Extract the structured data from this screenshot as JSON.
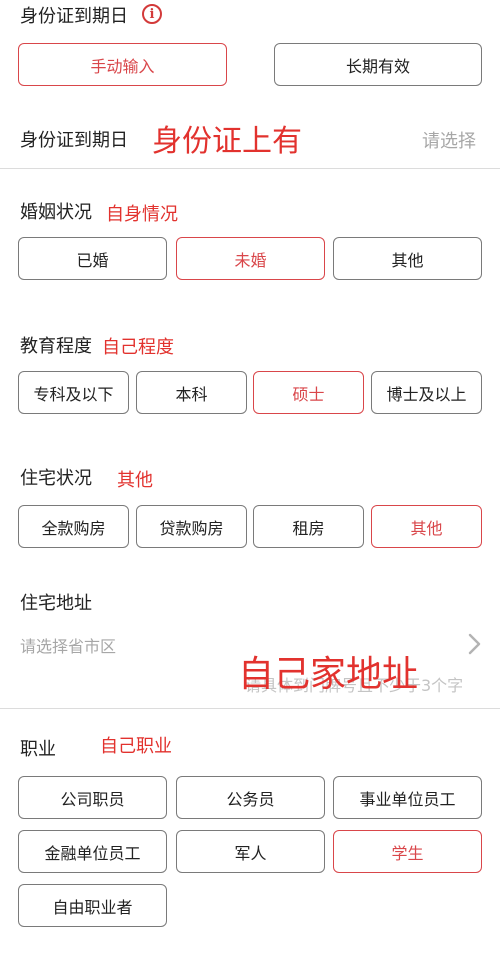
{
  "id_expiry_top": {
    "label": "身份证到期日",
    "info_icon": "i",
    "options": [
      "手动输入",
      "长期有效"
    ],
    "selected": "手动输入"
  },
  "id_expiry_row": {
    "label": "身份证到期日",
    "annotation": "身份证上有",
    "placeholder": "请选择"
  },
  "marital": {
    "label": "婚姻状况",
    "annotation": "自身情况",
    "options": [
      "已婚",
      "未婚",
      "其他"
    ],
    "selected": "未婚"
  },
  "education": {
    "label": "教育程度",
    "annotation": "自己程度",
    "options": [
      "专科及以下",
      "本科",
      "硕士",
      "博士及以上"
    ],
    "selected": "硕士"
  },
  "housing": {
    "label": "住宅状况",
    "annotation": "其他",
    "options": [
      "全款购房",
      "贷款购房",
      "租房",
      "其他"
    ],
    "selected": "其他"
  },
  "address": {
    "label": "住宅地址",
    "placeholder": "请选择省市区",
    "detail_hint": "请具体到门牌号且不少于3个字",
    "annotation": "自己家地址"
  },
  "occupation": {
    "label": "职业",
    "annotation": "自己职业",
    "options": [
      "公司职员",
      "公务员",
      "事业单位员工",
      "金融单位员工",
      "军人",
      "学生",
      "自由职业者"
    ],
    "selected": "学生"
  },
  "colors": {
    "accent": "#d9464a",
    "annotation": "#e2322e",
    "hint": "#a7a7a7",
    "border": "#7a7a7a",
    "divider": "#dcdcdc"
  },
  "icons": {
    "info": "info-circle-icon",
    "chevron": "chevron-right-icon"
  }
}
